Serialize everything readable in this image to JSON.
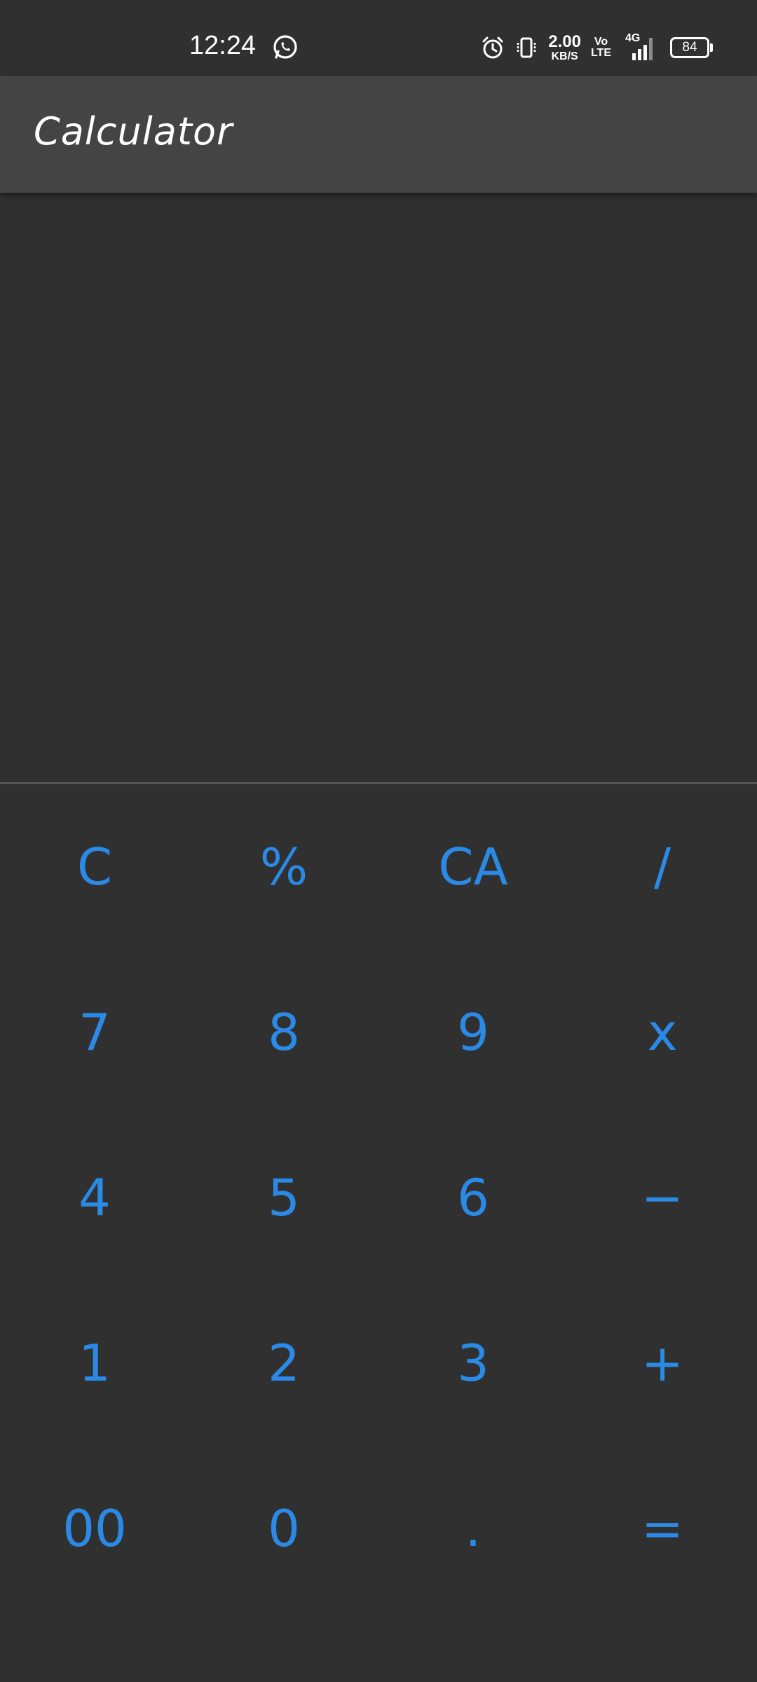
{
  "status_bar": {
    "time": "12:24",
    "net_speed_value": "2.00",
    "net_speed_unit": "KB/S",
    "volte_top": "Vo",
    "volte_bottom": "LTE",
    "network_type": "4G",
    "battery_level": "84",
    "icons": [
      "whatsapp-icon",
      "alarm-icon",
      "vibrate-icon",
      "signal-icon",
      "battery-icon"
    ]
  },
  "app_bar": {
    "title": "Calculator"
  },
  "display": {
    "expression": "",
    "result": ""
  },
  "keypad": {
    "accent_color": "#2a8ae6",
    "keys": [
      "C",
      "%",
      "CA",
      "/",
      "7",
      "8",
      "9",
      "x",
      "4",
      "5",
      "6",
      "−",
      "1",
      "2",
      "3",
      "+",
      "00",
      "0",
      ".",
      "="
    ]
  },
  "colors": {
    "background": "#303030",
    "app_bar": "#444444",
    "text": "#ffffff"
  }
}
